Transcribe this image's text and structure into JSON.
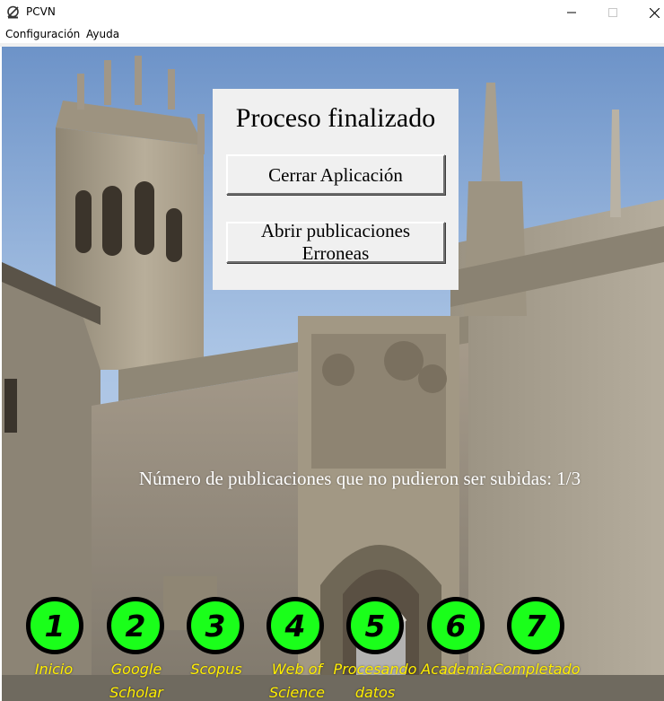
{
  "window": {
    "title": "PCVN"
  },
  "menu": {
    "items": [
      "Configuración",
      "Ayuda"
    ]
  },
  "panel": {
    "title": "Proceso finalizado",
    "close_button": "Cerrar Aplicación",
    "open_button_line1": "Abrir publicaciones",
    "open_button_line2": "Erroneas"
  },
  "status": {
    "message": "Número de publicaciones que no pudieron ser subidas: 1/3"
  },
  "steps": [
    {
      "number": "1",
      "label": [
        "Inicio"
      ]
    },
    {
      "number": "2",
      "label": [
        "Google",
        "Scholar"
      ]
    },
    {
      "number": "3",
      "label": [
        "Scopus"
      ]
    },
    {
      "number": "4",
      "label": [
        "Web of",
        "Science"
      ]
    },
    {
      "number": "5",
      "label": [
        "Procesando",
        "datos"
      ]
    },
    {
      "number": "6",
      "label": [
        "Academia"
      ]
    },
    {
      "number": "7",
      "label": [
        "Completado"
      ]
    }
  ],
  "colors": {
    "step_fill": "#1aff1a",
    "step_label": "#ffee00",
    "panel_bg": "#f0f0f0"
  },
  "icons": {
    "app": "app-logo-icon",
    "minimize": "minimize-icon",
    "maximize": "maximize-icon",
    "close": "close-icon"
  }
}
